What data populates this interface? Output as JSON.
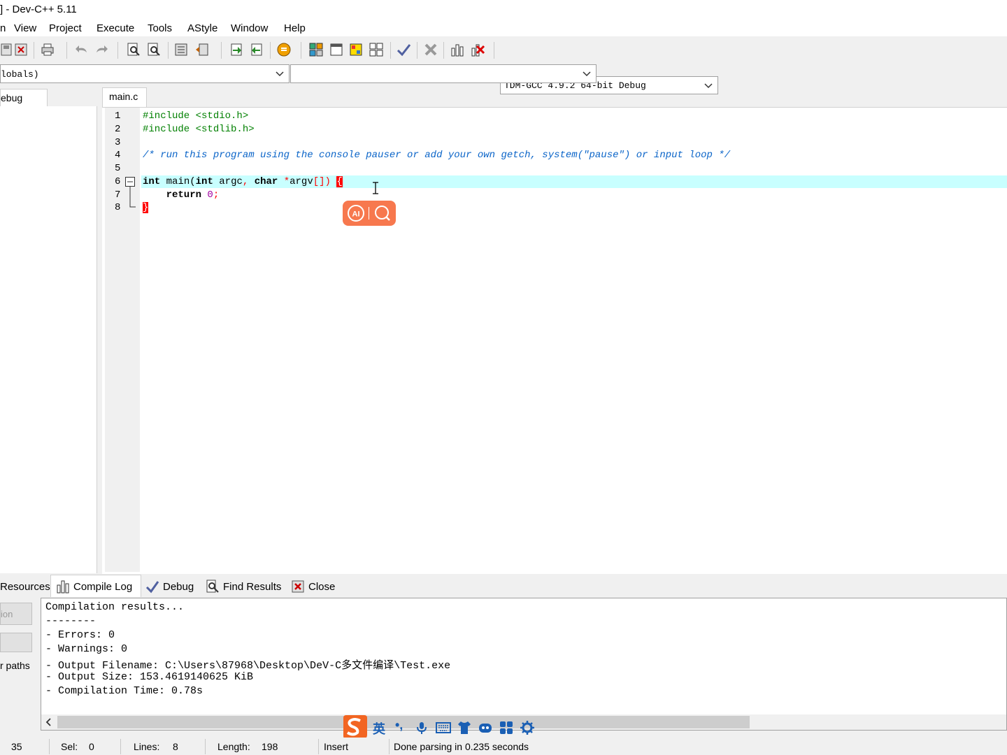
{
  "window": {
    "title": "] - Dev-C++ 5.11"
  },
  "menu": [
    "n",
    "View",
    "Project",
    "Execute",
    "Tools",
    "AStyle",
    "Window",
    "Help"
  ],
  "compiler": {
    "selected": "TDM-GCC 4.9.2 64-bit Debug"
  },
  "scope_combo": {
    "left_value": "lobals)",
    "right_value": ""
  },
  "left_panel": {
    "tab_label": "ebug"
  },
  "editor": {
    "tab": "main.c",
    "line_numbers": [
      "1",
      "2",
      "3",
      "4",
      "5",
      "6",
      "7",
      "8"
    ],
    "lines": {
      "l1": "#include <stdio.h>",
      "l2": "#include <stdlib.h>",
      "l4": "/* run this program using the console pauser or add your own getch, system(\"pause\") or input loop */",
      "l6a": "int",
      "l6b": " main(",
      "l6c": "int",
      "l6d": " argc",
      "l6e": ", ",
      "l6f": "char",
      "l6g": " *",
      "l6h": "argv",
      "l6i": "[])",
      "l6j": " ",
      "l6k": "{",
      "l7a": "    return ",
      "l7b": "0",
      "l7c": ";",
      "l8": "}"
    }
  },
  "bottom_tabs": {
    "resources": "Resources",
    "compile_log": "Compile Log",
    "debug": "Debug",
    "find_results": "Find Results",
    "close": "Close"
  },
  "side_buttons": {
    "b1": "ion",
    "b2": "",
    "paths": "r paths"
  },
  "compile_log": [
    "Compilation results...",
    "--------",
    "- Errors: 0",
    "- Warnings: 0",
    "- Output Filename: C:\\Users\\87968\\Desktop\\DeV-C多文件编译\\Test.exe",
    "- Output Size: 153.4619140625 KiB",
    "- Compilation Time: 0.78s"
  ],
  "status": {
    "col": "35",
    "sel_label": "Sel:",
    "sel": "0",
    "lines_label": "Lines:",
    "lines": "8",
    "length_label": "Length:",
    "length": "198",
    "mode": "Insert",
    "message": "Done parsing in 0.235 seconds"
  },
  "ime": {
    "lang": "英",
    "punct": "•,"
  },
  "colors": {
    "highlight_line": "#c8ffff",
    "brace": "#ff0000",
    "ai_button": "#f7784e"
  }
}
